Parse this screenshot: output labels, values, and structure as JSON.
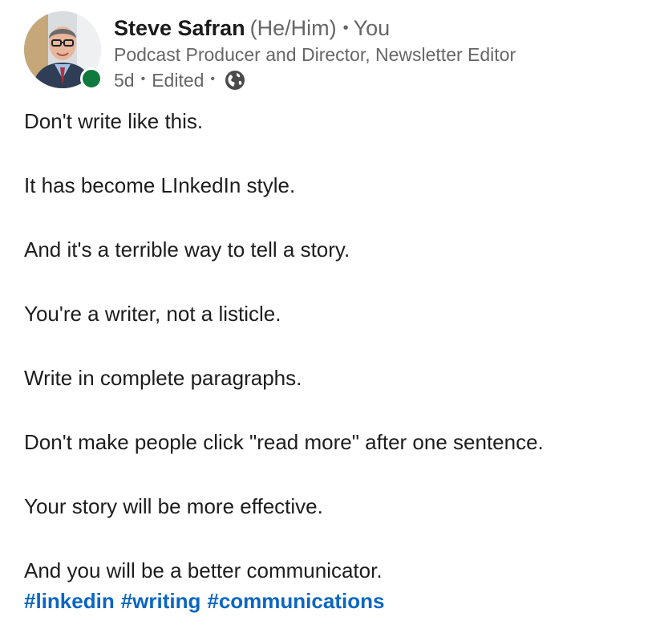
{
  "author": {
    "name": "Steve Safran",
    "pronouns": "(He/Him)",
    "relationship_separator": "•",
    "relationship": "You",
    "headline": "Podcast Producer and Director, Newsletter Editor",
    "presence_status": "online",
    "avatar_icon": "profile-photo"
  },
  "post_meta": {
    "age": "5d",
    "separator_1": "•",
    "edited": "Edited",
    "separator_2": "•",
    "visibility_icon": "globe-icon"
  },
  "content": {
    "paragraphs": [
      "Don't write like this.",
      "It has become LInkedIn style.",
      "And it's a terrible way to tell a story.",
      "You're a writer, not a listicle.",
      "Write in complete paragraphs.",
      "Don't make people click \"read more\" after one sentence.",
      "Your story will be more effective.",
      "And you will be a better communicator."
    ],
    "hashtags": [
      "#linkedin",
      "#writing",
      "#communications"
    ]
  },
  "colors": {
    "link": "#0a66c2",
    "presence": "#0f7a3d",
    "secondary_text": "#666666"
  }
}
